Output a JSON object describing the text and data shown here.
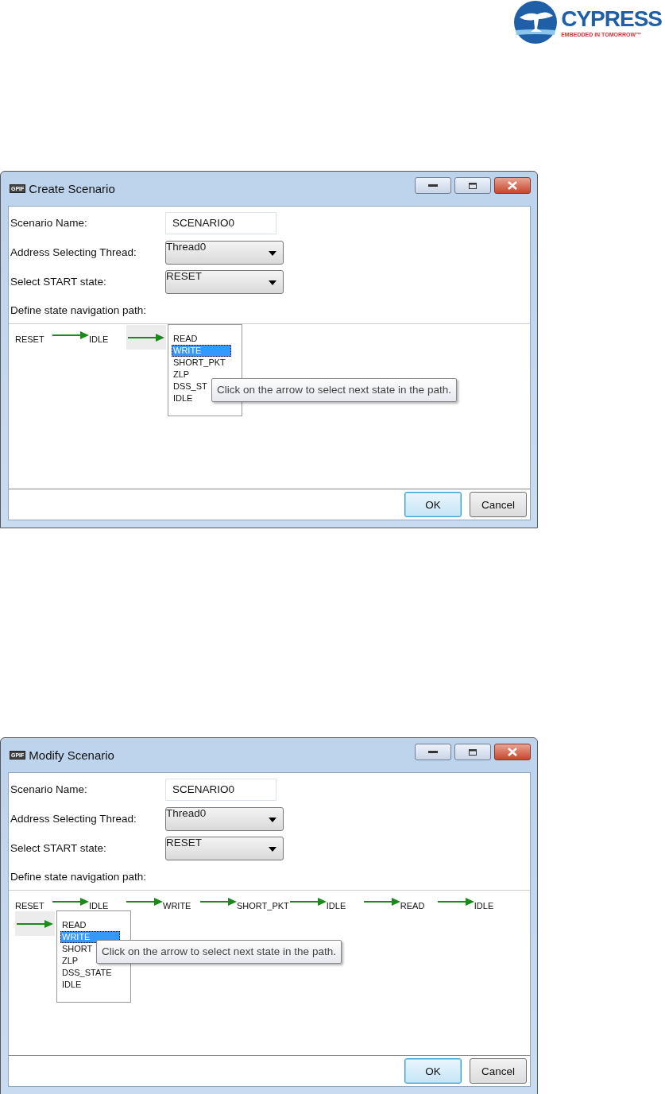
{
  "logo": {
    "name": "CYPRESS",
    "tagline": "EMBEDDED IN TOMORROW™"
  },
  "dialogs": [
    {
      "title": "Create Scenario",
      "icon_text": "GPIF",
      "fields": [
        {
          "kind": "text",
          "label": "Scenario Name:",
          "value": "SCENARIO0"
        },
        {
          "kind": "dropdown",
          "label": "Address Selecting Thread:",
          "value": "Thread0"
        },
        {
          "kind": "dropdown",
          "label": "Select START state:",
          "value": "RESET"
        }
      ],
      "path_label": "Define state navigation path:",
      "path": [
        "RESET",
        "IDLE"
      ],
      "state_list": [
        {
          "label": "READ",
          "selected": false
        },
        {
          "label": "WRITE",
          "selected": true
        },
        {
          "label": "SHORT_PKT",
          "selected": false
        },
        {
          "label": "ZLP",
          "selected": false
        },
        {
          "label": "DSS_ST",
          "selected": false
        },
        {
          "label": "IDLE",
          "selected": false
        }
      ],
      "tooltip": "Click on the arrow to select next state in the path.",
      "buttons": [
        {
          "label": "OK",
          "default": true
        },
        {
          "label": "Cancel",
          "default": false
        }
      ]
    },
    {
      "title": "Modify Scenario",
      "icon_text": "GPIF",
      "fields": [
        {
          "kind": "text",
          "label": "Scenario Name:",
          "value": "SCENARIO0"
        },
        {
          "kind": "dropdown",
          "label": "Address Selecting Thread:",
          "value": "Thread0"
        },
        {
          "kind": "dropdown",
          "label": "Select START state:",
          "value": "RESET"
        }
      ],
      "path_label": "Define state navigation path:",
      "path": [
        "RESET",
        "IDLE",
        "WRITE",
        "SHORT_PKT",
        "IDLE",
        "READ",
        "IDLE"
      ],
      "state_list": [
        {
          "label": "READ",
          "selected": false
        },
        {
          "label": "WRITE",
          "selected": true
        },
        {
          "label": "SHORT",
          "selected": false
        },
        {
          "label": "ZLP",
          "selected": false
        },
        {
          "label": "DSS_STATE",
          "selected": false
        },
        {
          "label": "IDLE",
          "selected": false
        }
      ],
      "tooltip": "Click on the arrow to select next state in the path.",
      "buttons": [
        {
          "label": "OK",
          "default": true
        },
        {
          "label": "Cancel",
          "default": false
        }
      ]
    }
  ]
}
